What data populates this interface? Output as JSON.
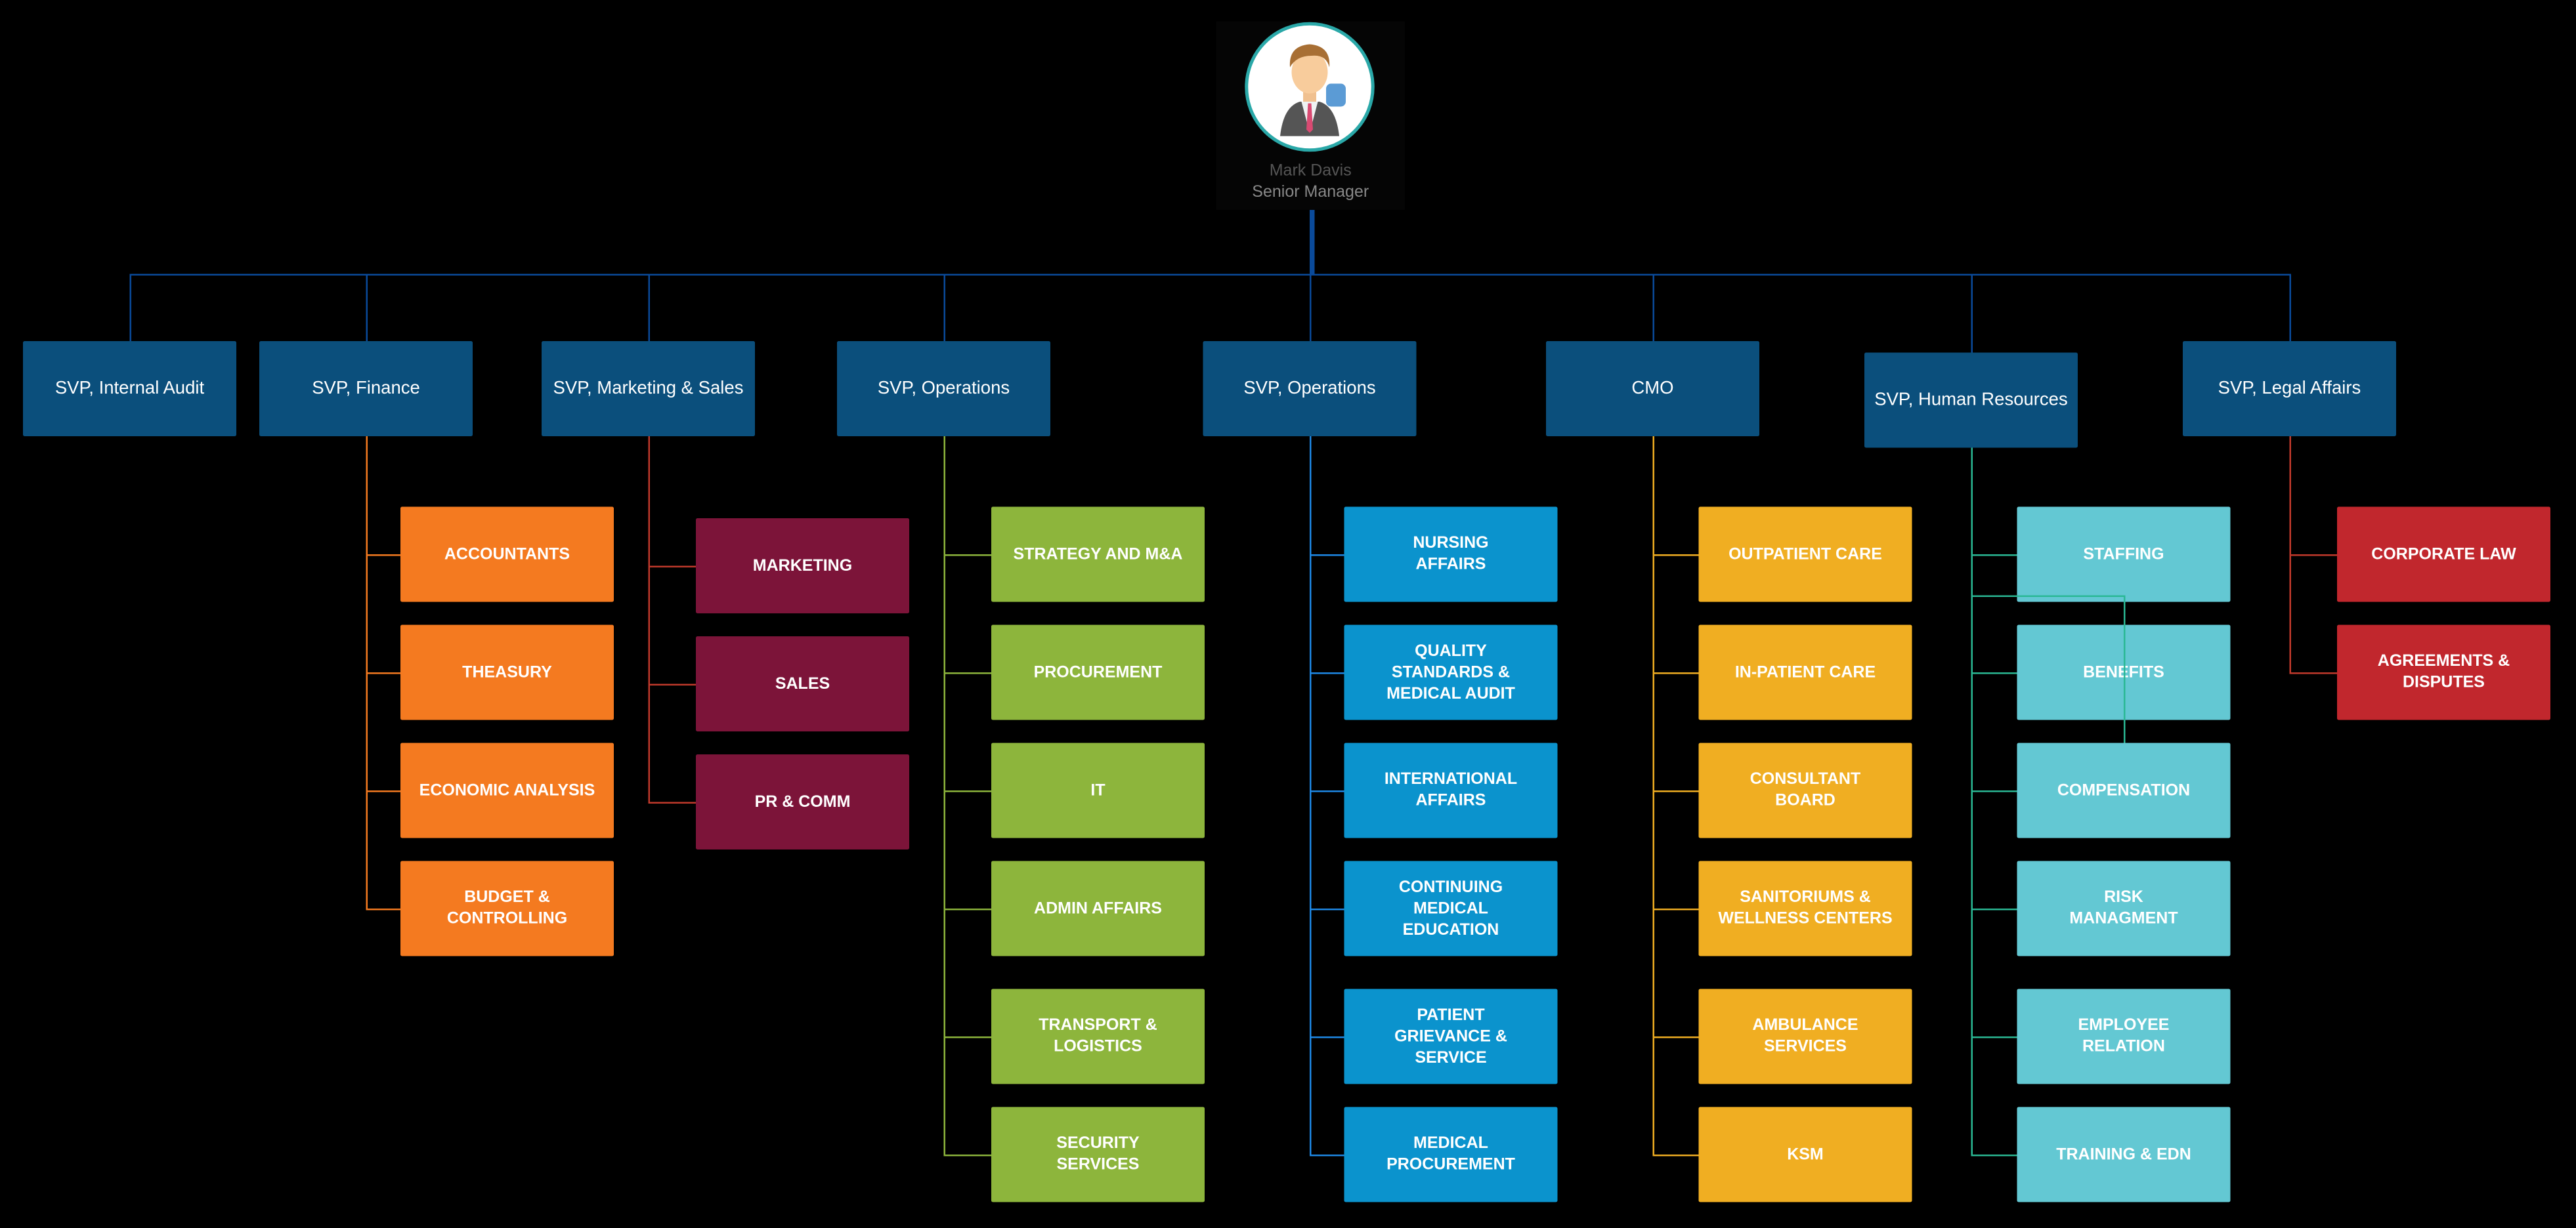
{
  "manager": {
    "name": "Mark Davis",
    "title": "Senior Manager",
    "avatar_icon": "person-avatar-icon",
    "connector_color": "#0a4a9a"
  },
  "departments": [
    {
      "label": "SVP, Internal Audit",
      "color": "#0b4f7c",
      "line_color": "#0a4a9a",
      "children": []
    },
    {
      "label": "SVP, Finance",
      "color": "#0b4f7c",
      "child_color": "#f47a20",
      "line_color": "#f47a20",
      "children": [
        "ACCOUNTANTS",
        "THEASURY",
        "ECONOMIC ANALYSIS",
        "BUDGET &\nCONTROLLING"
      ]
    },
    {
      "label": "SVP, Marketing & Sales",
      "color": "#0b4f7c",
      "child_color": "#7c1439",
      "line_color": "#c0392b",
      "children": [
        "MARKETING",
        "SALES",
        "PR & COMM"
      ]
    },
    {
      "label": "SVP, Operations",
      "color": "#0b4f7c",
      "child_color": "#8db53c",
      "line_color": "#8db53c",
      "children": [
        "STRATEGY AND M&A",
        "PROCUREMENT",
        "IT",
        "ADMIN AFFAIRS",
        "TRANSPORT &\nLOGISTICS",
        "SECURITY\nSERVICES"
      ]
    },
    {
      "label": "SVP, Operations",
      "color": "#0b4f7c",
      "child_color": "#0b93cd",
      "line_color": "#1e88e5",
      "children": [
        "NURSING\nAFFAIRS",
        "QUALITY\nSTANDARDS &\nMEDICAL AUDIT",
        "INTERNATIONAL\nAFFAIRS",
        "CONTINUING\nMEDICAL\nEDUCATION",
        "PATIENT\nGRIEVANCE &\nSERVICE",
        "MEDICAL\nPROCUREMENT"
      ]
    },
    {
      "label": "CMO",
      "color": "#0b4f7c",
      "child_color": "#f0ae22",
      "line_color": "#f0ae22",
      "children": [
        "OUTPATIENT CARE",
        "IN-PATIENT CARE",
        "CONSULTANT\nBOARD",
        "SANITORIUMS &\nWELLNESS CENTERS",
        "AMBULANCE\nSERVICES",
        "KSM"
      ]
    },
    {
      "label": "SVP, Human Resources",
      "color": "#0b4f7c",
      "child_color": "#63c8d3",
      "line_color": "#2ab894",
      "children": [
        "STAFFING",
        "BENEFITS",
        "COMPENSATION",
        "RISK\nMANAGMENT",
        "EMPLOYEE\nRELATION",
        "TRAINING & EDN"
      ]
    },
    {
      "label": "SVP, Legal Affairs",
      "color": "#0b4f7c",
      "child_color": "#c1272d",
      "line_color": "#c0392b",
      "children": [
        "CORPORATE LAW",
        "AGREEMENTS &\nDISPUTES"
      ]
    }
  ]
}
